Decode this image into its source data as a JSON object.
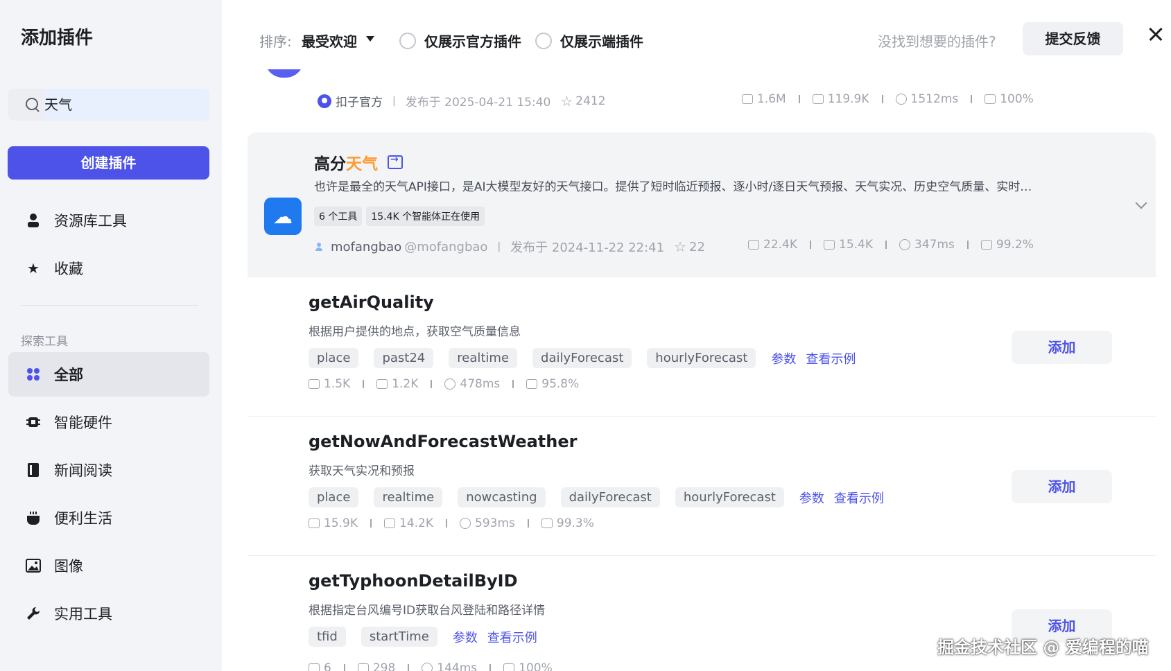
{
  "sidebar": {
    "title": "添加插件",
    "search_value": "天气",
    "create_label": "创建插件",
    "items_top": [
      {
        "label": "资源库工具",
        "icon": "user-icon"
      },
      {
        "label": "收藏",
        "icon": "star-icon"
      }
    ],
    "section_label": "探索工具",
    "items": [
      {
        "label": "全部",
        "icon": "grid-icon",
        "active": true
      },
      {
        "label": "智能硬件",
        "icon": "chip-icon"
      },
      {
        "label": "新闻阅读",
        "icon": "book-icon"
      },
      {
        "label": "便利生活",
        "icon": "cup-icon"
      },
      {
        "label": "图像",
        "icon": "image-icon"
      },
      {
        "label": "实用工具",
        "icon": "wrench-icon"
      }
    ]
  },
  "header": {
    "sort_label": "排序:",
    "sort_value": "最受欢迎",
    "filter_official": "仅展示官方插件",
    "filter_device": "仅展示端插件",
    "not_found": "没找到想要的插件?",
    "feedback": "提交反馈"
  },
  "prev_plugin": {
    "publisher": "扣子官方",
    "published": "发布于 2025-04-21 15:40",
    "stars": "2412",
    "stats": [
      "1.6M",
      "119.9K",
      "1512ms",
      "100%"
    ]
  },
  "plugin": {
    "title_prefix": "高分",
    "title_highlight": "天气",
    "description": "也许是最全的天气API接口，是AI大模型友好的天气接口。提供了短时临近预报、逐小时/逐日天气预报、天气实况、历史空气质量、实时…",
    "tag_tools": "6 个工具",
    "tag_usage": "15.4K 个智能体正在使用",
    "author": "mofangbao",
    "handle": "@mofangbao",
    "published": "发布于 2024-11-22 22:41",
    "stars": "22",
    "stats": [
      "22.4K",
      "15.4K",
      "347ms",
      "99.2%"
    ]
  },
  "tools": [
    {
      "name": "getAirQuality",
      "desc": "根据用户提供的地点，获取空气质量信息",
      "params": [
        "place",
        "past24",
        "realtime",
        "dailyForecast",
        "hourlyForecast"
      ],
      "stats": [
        "1.5K",
        "1.2K",
        "478ms",
        "95.8%"
      ]
    },
    {
      "name": "getNowAndForecastWeather",
      "desc": "获取天气实况和预报",
      "params": [
        "place",
        "realtime",
        "nowcasting",
        "dailyForecast",
        "hourlyForecast"
      ],
      "stats": [
        "15.9K",
        "14.2K",
        "593ms",
        "99.3%"
      ]
    },
    {
      "name": "getTyphoonDetailByID",
      "desc": "根据指定台风编号ID获取台风登陆和路径详情",
      "params": [
        "tfid",
        "startTime"
      ],
      "stats": [
        "6",
        "298",
        "144ms",
        "100%"
      ]
    }
  ],
  "labels": {
    "params_link": "参数",
    "example_link": "查看示例",
    "add": "添加"
  },
  "watermark": "掘金技术社区 @ 爱编程的喵"
}
